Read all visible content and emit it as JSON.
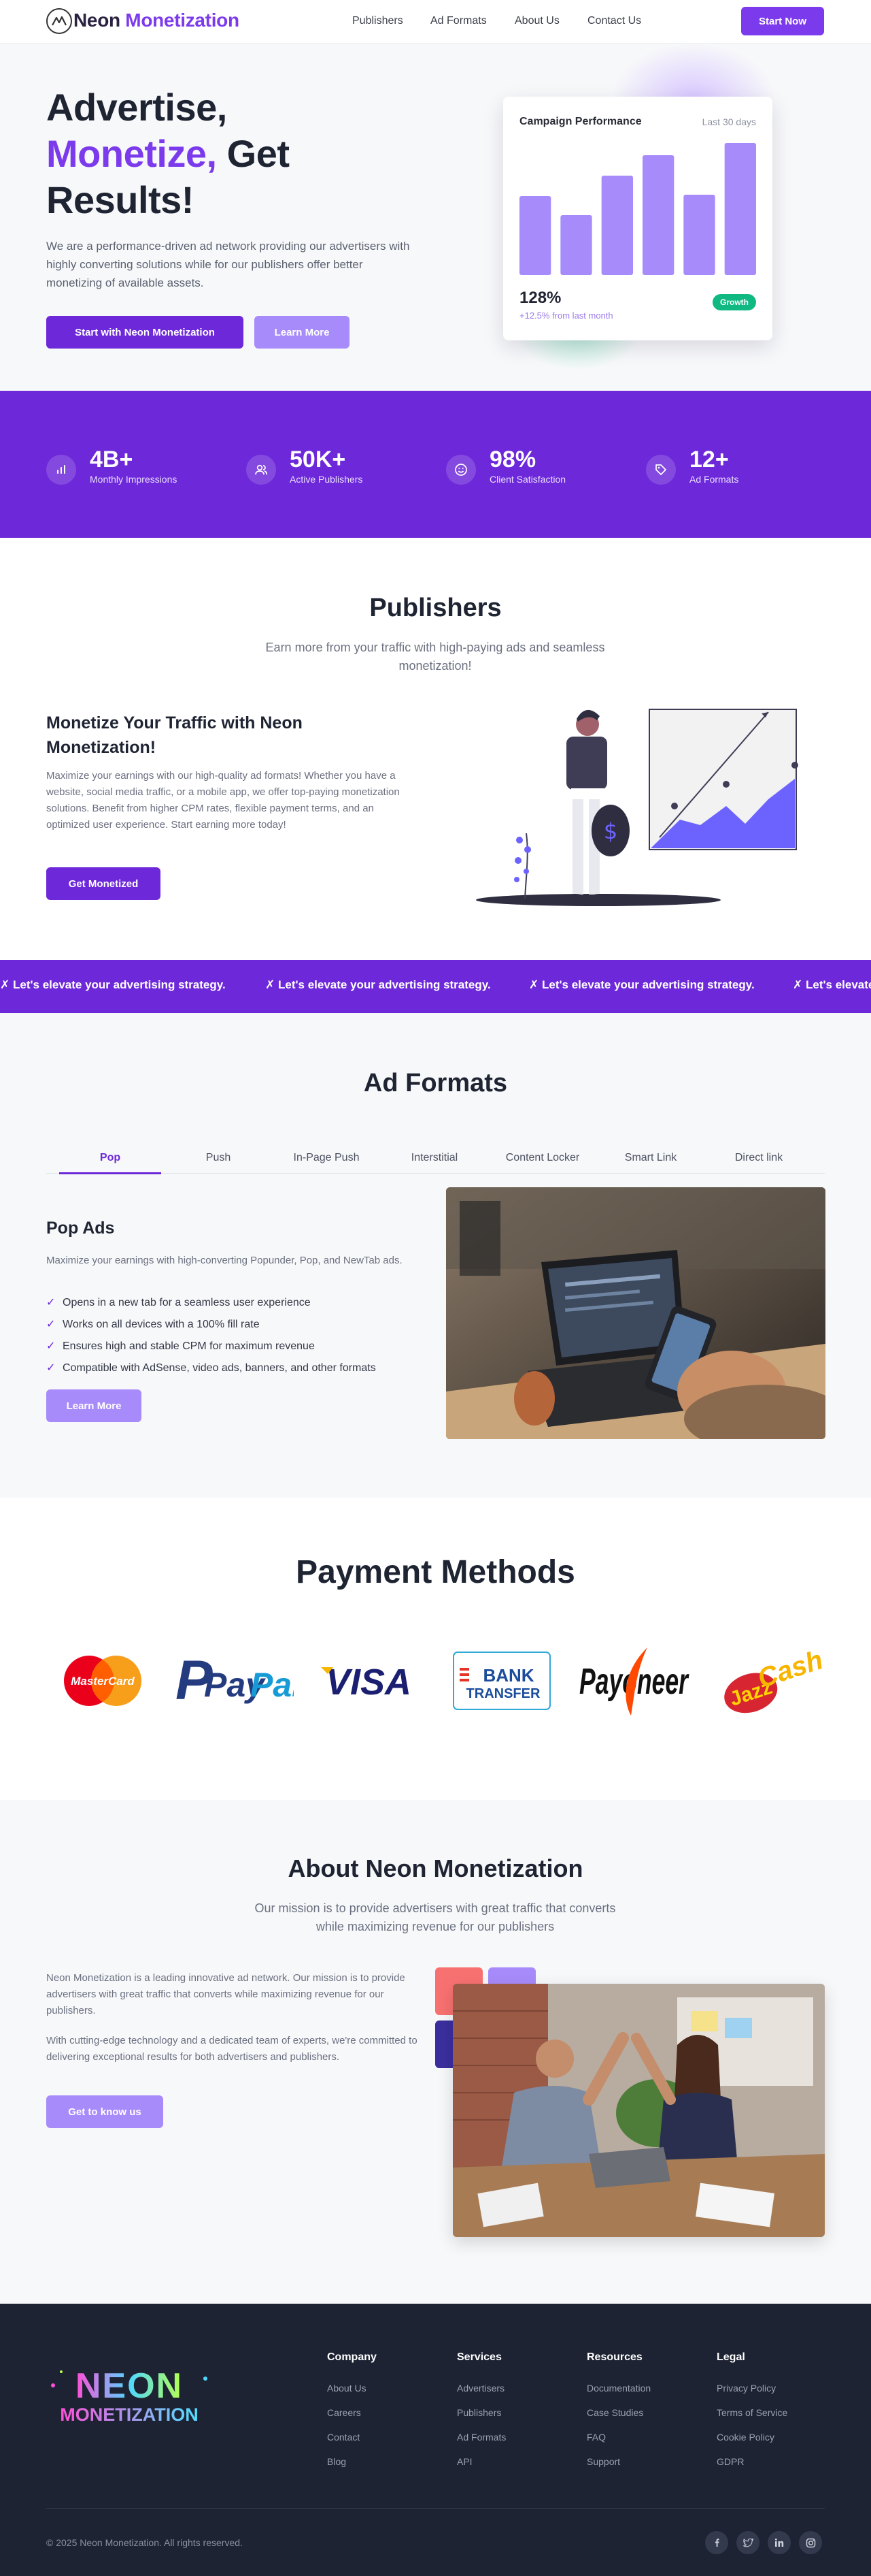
{
  "header": {
    "brand_part1": "Neon",
    "brand_part2": "Monetization",
    "nav": [
      "Publishers",
      "Ad Formats",
      "About Us",
      "Contact Us"
    ],
    "cta": "Start Now"
  },
  "hero": {
    "title_line1": "Advertise,",
    "title_accent": "Monetize,",
    "title_get": " Get",
    "title_line3": "Results!",
    "description": "We are a performance-driven ad network providing our advertisers with highly converting solutions while for our publishers offer better monetizing of available assets.",
    "primary_button": "Start with Neon Monetization",
    "secondary_button": "Learn More",
    "card": {
      "title": "Campaign Performance",
      "period": "Last 30 days",
      "bar_levels": [
        0.58,
        0.44,
        0.73,
        0.88,
        0.59,
        0.97
      ],
      "value": "128%",
      "delta": "+12.5% from last month",
      "badge": "Growth"
    }
  },
  "stats": [
    {
      "icon": "bar-chart-icon",
      "value": "4B+",
      "label": "Monthly Impressions"
    },
    {
      "icon": "users-icon",
      "value": "50K+",
      "label": "Active Publishers"
    },
    {
      "icon": "smile-icon",
      "value": "98%",
      "label": "Client Satisfaction"
    },
    {
      "icon": "tag-icon",
      "value": "12+",
      "label": "Ad Formats"
    }
  ],
  "publishers": {
    "title": "Publishers",
    "subtitle": "Earn more from your traffic with high-paying ads and seamless monetization!",
    "heading": "Monetize Your Traffic with Neon Monetization!",
    "body": "Maximize your earnings with our high-quality ad formats! Whether you have a website, social media traffic, or a mobile app, we offer top-paying monetization solutions. Benefit from higher CPM rates, flexible payment terms, and an optimized user experience. Start earning more today!",
    "button": "Get Monetized"
  },
  "marquee": {
    "text": "Let's elevate your advertising strategy.",
    "icon": "tools-icon"
  },
  "ad_formats": {
    "title": "Ad Formats",
    "tabs": [
      "Pop",
      "Push",
      "In-Page Push",
      "Interstitial",
      "Content Locker",
      "Smart Link",
      "Direct link"
    ],
    "active_tab": "Pop",
    "heading": "Pop Ads",
    "description": "Maximize your earnings with high-converting Popunder, Pop, and NewTab ads.",
    "features": [
      "Opens in a new tab for a seamless user experience",
      "Works on all devices with a 100% fill rate",
      "Ensures high and stable CPM for maximum revenue",
      "Compatible with AdSense, video ads, banners, and other formats"
    ],
    "button": "Learn More"
  },
  "payment": {
    "title": "Payment Methods",
    "methods": [
      "MasterCard",
      "PayPal",
      "VISA",
      "BANK TRANSFER",
      "Payoneer",
      "JazzCash"
    ],
    "mastercard": "MasterCard",
    "paypal_a": "Pay",
    "paypal_b": "Pal",
    "visa": "VISA",
    "bank_line1": "BANK",
    "bank_line2": "TRANSFER",
    "payoneer": "Payoneer",
    "jazz": "Jazz",
    "cash": "Cash"
  },
  "about": {
    "title": "About Neon Monetization",
    "subtitle": "Our mission is to provide advertisers with great traffic that converts while maximizing revenue for our publishers",
    "para1": "Neon Monetization is a leading innovative ad network. Our mission is to provide advertisers with great traffic that converts while maximizing revenue for our publishers.",
    "para2": "With cutting-edge technology and a dedicated team of experts, we're committed to delivering exceptional results for both advertisers and publishers.",
    "button": "Get to know us"
  },
  "footer": {
    "logo_line1": "NEON",
    "logo_line2": "MONETIZATION",
    "columns": [
      {
        "title": "Company",
        "links": [
          "About Us",
          "Careers",
          "Contact",
          "Blog"
        ]
      },
      {
        "title": "Services",
        "links": [
          "Advertisers",
          "Publishers",
          "Ad Formats",
          "API"
        ]
      },
      {
        "title": "Resources",
        "links": [
          "Documentation",
          "Case Studies",
          "FAQ",
          "Support"
        ]
      },
      {
        "title": "Legal",
        "links": [
          "Privacy Policy",
          "Terms of Service",
          "Cookie Policy",
          "GDPR"
        ]
      }
    ],
    "copyright": "© 2025 Neon Monetization. All rights reserved.",
    "social": [
      "facebook-icon",
      "twitter-icon",
      "linkedin-icon",
      "instagram-icon"
    ]
  },
  "colors": {
    "primary": "#6d28d9",
    "primary_light": "#a78bfa",
    "accent": "#7c3aed",
    "success": "#10b981",
    "footer_bg": "#1e2333"
  }
}
